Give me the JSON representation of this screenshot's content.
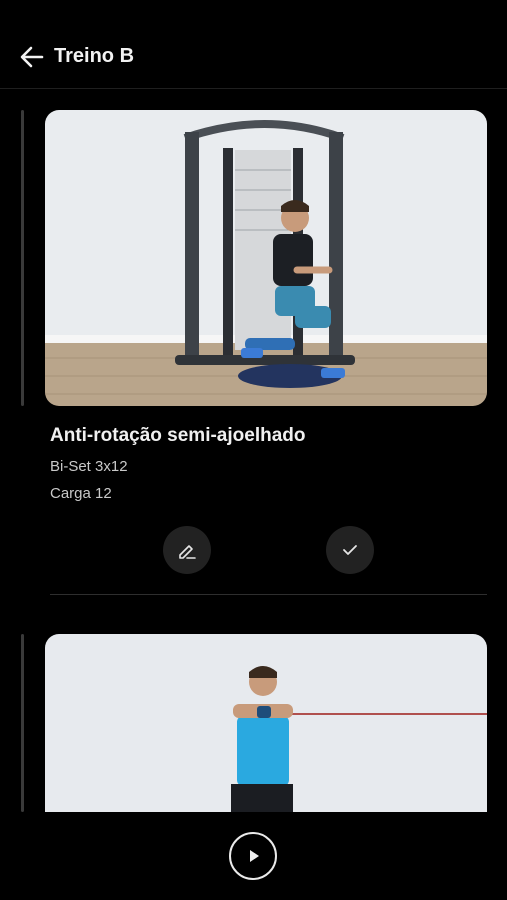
{
  "header": {
    "title": "Treino B",
    "back_icon": "arrow-left-icon"
  },
  "exercises": [
    {
      "name": "Anti-rotação semi-ajoelhado",
      "sets": "Bi-Set 3x12",
      "load": "Carga 12",
      "actions": {
        "edit_icon": "pencil-icon",
        "done_icon": "check-icon"
      }
    }
  ],
  "player": {
    "play_icon": "play-icon"
  },
  "colors": {
    "background": "#000000",
    "button": "#222222",
    "rail": "#3a3a3a"
  }
}
